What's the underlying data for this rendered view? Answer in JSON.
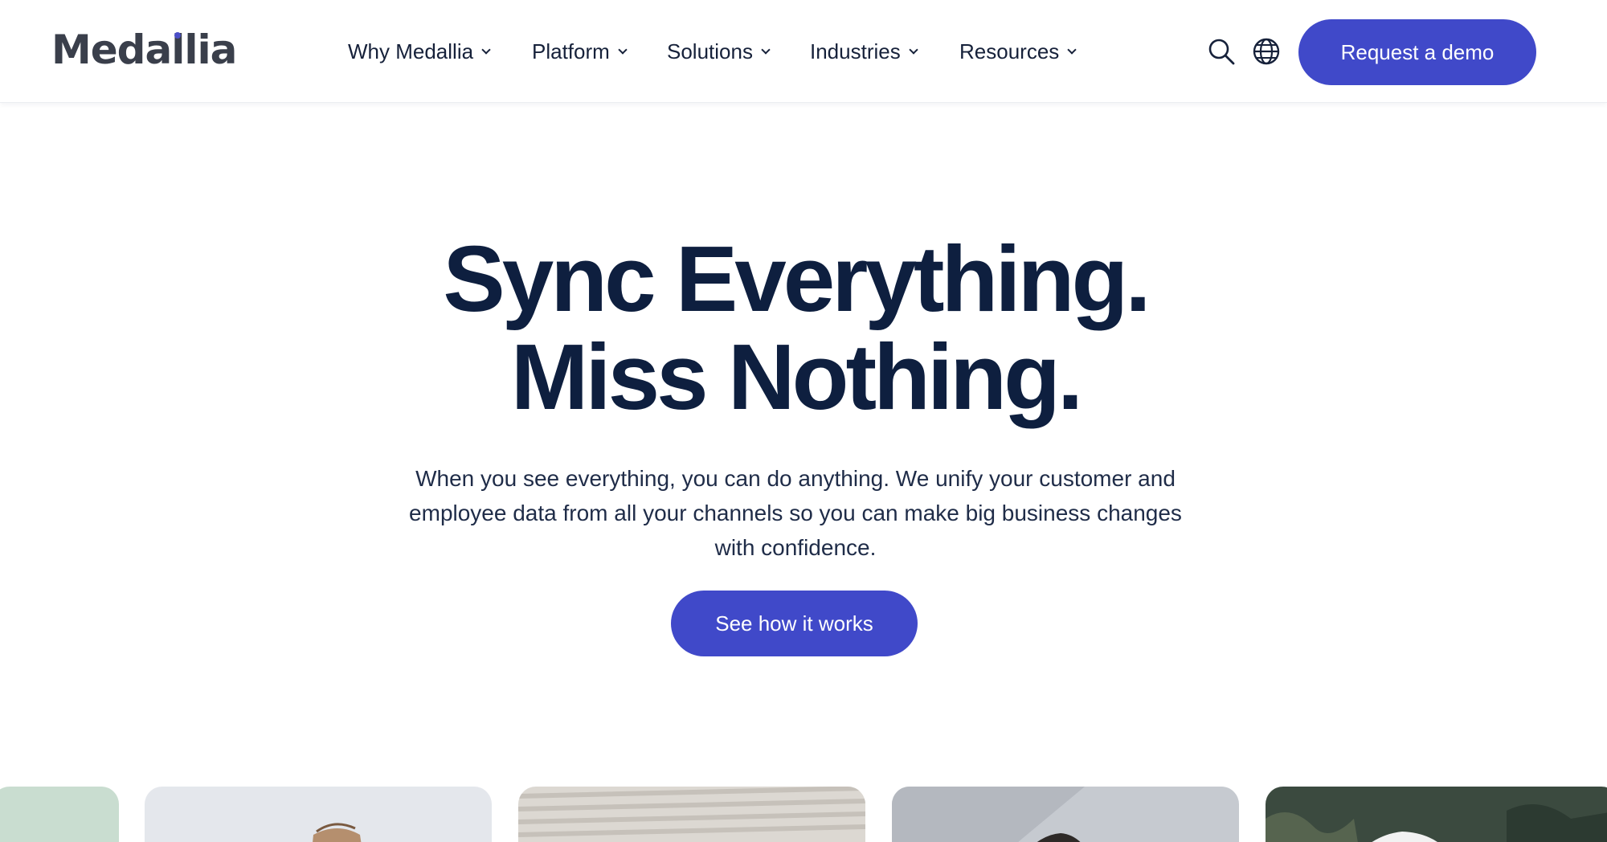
{
  "brand": {
    "name": "Medallia",
    "accent": "#4049c9",
    "text_color": "#0e1f3f"
  },
  "nav": {
    "items": [
      {
        "label": "Why Medallia"
      },
      {
        "label": "Platform"
      },
      {
        "label": "Solutions"
      },
      {
        "label": "Industries"
      },
      {
        "label": "Resources"
      }
    ],
    "icons": [
      "search-icon",
      "globe-icon",
      "chevron-down-icon"
    ],
    "cta_label": "Request a demo"
  },
  "hero": {
    "title_line1": "Sync Everything.",
    "title_line2": "Miss Nothing.",
    "subtitle": "When you see everything, you can do anything. We unify your customer and employee data from all your channels so you can make big business changes with confidence.",
    "cta_label": "See how it works"
  },
  "carousel": {
    "cards": [
      {
        "name": "card-partial-left",
        "bg": "#c9ddd0"
      },
      {
        "name": "card-person-1",
        "bg": "#e7eaee"
      },
      {
        "name": "card-person-2",
        "bg": "#d9d5cf"
      },
      {
        "name": "card-person-3",
        "bg": "#c5c9cf"
      },
      {
        "name": "card-person-4",
        "bg": "#3c4a40"
      }
    ]
  }
}
